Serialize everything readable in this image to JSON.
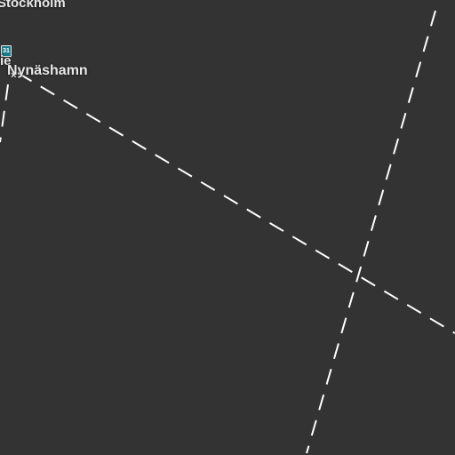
{
  "map": {
    "background_color": "#333333",
    "route_color": "#ffffff",
    "shield_color": "#1a7a8a",
    "labels": {
      "stockholm": "Stockholm",
      "nynashamn": "Nynäshamn",
      "partial_town": "ie"
    },
    "road_shield": "31",
    "port_marker": "×"
  }
}
